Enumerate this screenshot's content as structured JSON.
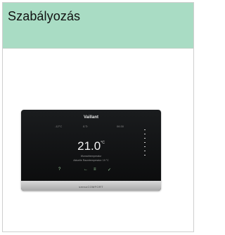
{
  "title": "Szabályozás",
  "device": {
    "brand": "Vaillant",
    "status_left": "-12°C",
    "status_mid": "∆ ↻",
    "status_right": "06:30",
    "temperature": "21.0",
    "temperature_unit": "°C",
    "label_line1": "Wunschtemperatur",
    "label_line2": "Aktuelle Raumtemperatur: 19 °C",
    "buttons": {
      "help": "?",
      "back": "←",
      "menu": "≡",
      "ok": "✓"
    },
    "model": "sensoCOMFORT"
  }
}
